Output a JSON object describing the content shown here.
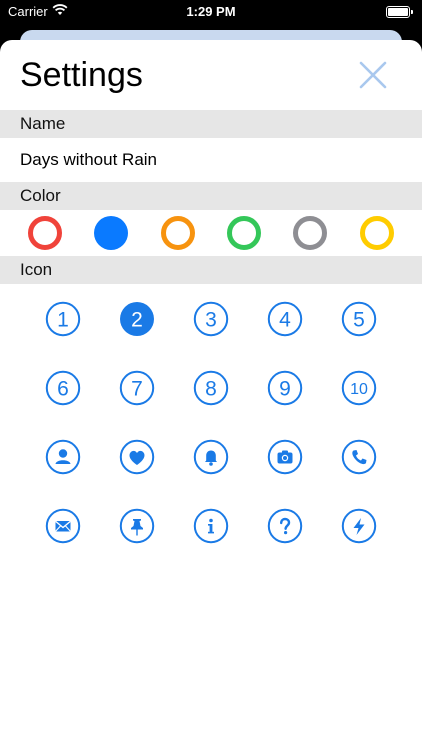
{
  "status": {
    "carrier": "Carrier",
    "time": "1:29 PM"
  },
  "title": "Settings",
  "sections": {
    "name": "Name",
    "color": "Color",
    "icon": "Icon"
  },
  "name_value": "Days without Rain",
  "accent": "#1a7ae6",
  "colors": [
    {
      "name": "red",
      "hex": "#f0433a",
      "selected": false
    },
    {
      "name": "blue",
      "hex": "#0a7aff",
      "selected": true
    },
    {
      "name": "orange",
      "hex": "#f7930f",
      "selected": false
    },
    {
      "name": "green",
      "hex": "#34c759",
      "selected": false
    },
    {
      "name": "gray",
      "hex": "#8e8e93",
      "selected": false
    },
    {
      "name": "yellow",
      "hex": "#ffcc00",
      "selected": false
    }
  ],
  "icons": [
    {
      "type": "number",
      "label": "1",
      "selected": false
    },
    {
      "type": "number",
      "label": "2",
      "selected": true
    },
    {
      "type": "number",
      "label": "3",
      "selected": false
    },
    {
      "type": "number",
      "label": "4",
      "selected": false
    },
    {
      "type": "number",
      "label": "5",
      "selected": false
    },
    {
      "type": "number",
      "label": "6",
      "selected": false
    },
    {
      "type": "number",
      "label": "7",
      "selected": false
    },
    {
      "type": "number",
      "label": "8",
      "selected": false
    },
    {
      "type": "number",
      "label": "9",
      "selected": false
    },
    {
      "type": "number",
      "label": "10",
      "selected": false
    },
    {
      "type": "glyph",
      "icon": "person-icon",
      "selected": false
    },
    {
      "type": "glyph",
      "icon": "heart-icon",
      "selected": false
    },
    {
      "type": "glyph",
      "icon": "bell-icon",
      "selected": false
    },
    {
      "type": "glyph",
      "icon": "camera-icon",
      "selected": false
    },
    {
      "type": "glyph",
      "icon": "phone-icon",
      "selected": false
    },
    {
      "type": "glyph",
      "icon": "envelope-icon",
      "selected": false
    },
    {
      "type": "glyph",
      "icon": "pin-icon",
      "selected": false
    },
    {
      "type": "glyph",
      "icon": "info-icon",
      "selected": false
    },
    {
      "type": "glyph",
      "icon": "question-icon",
      "selected": false
    },
    {
      "type": "glyph",
      "icon": "bolt-icon",
      "selected": false
    }
  ]
}
